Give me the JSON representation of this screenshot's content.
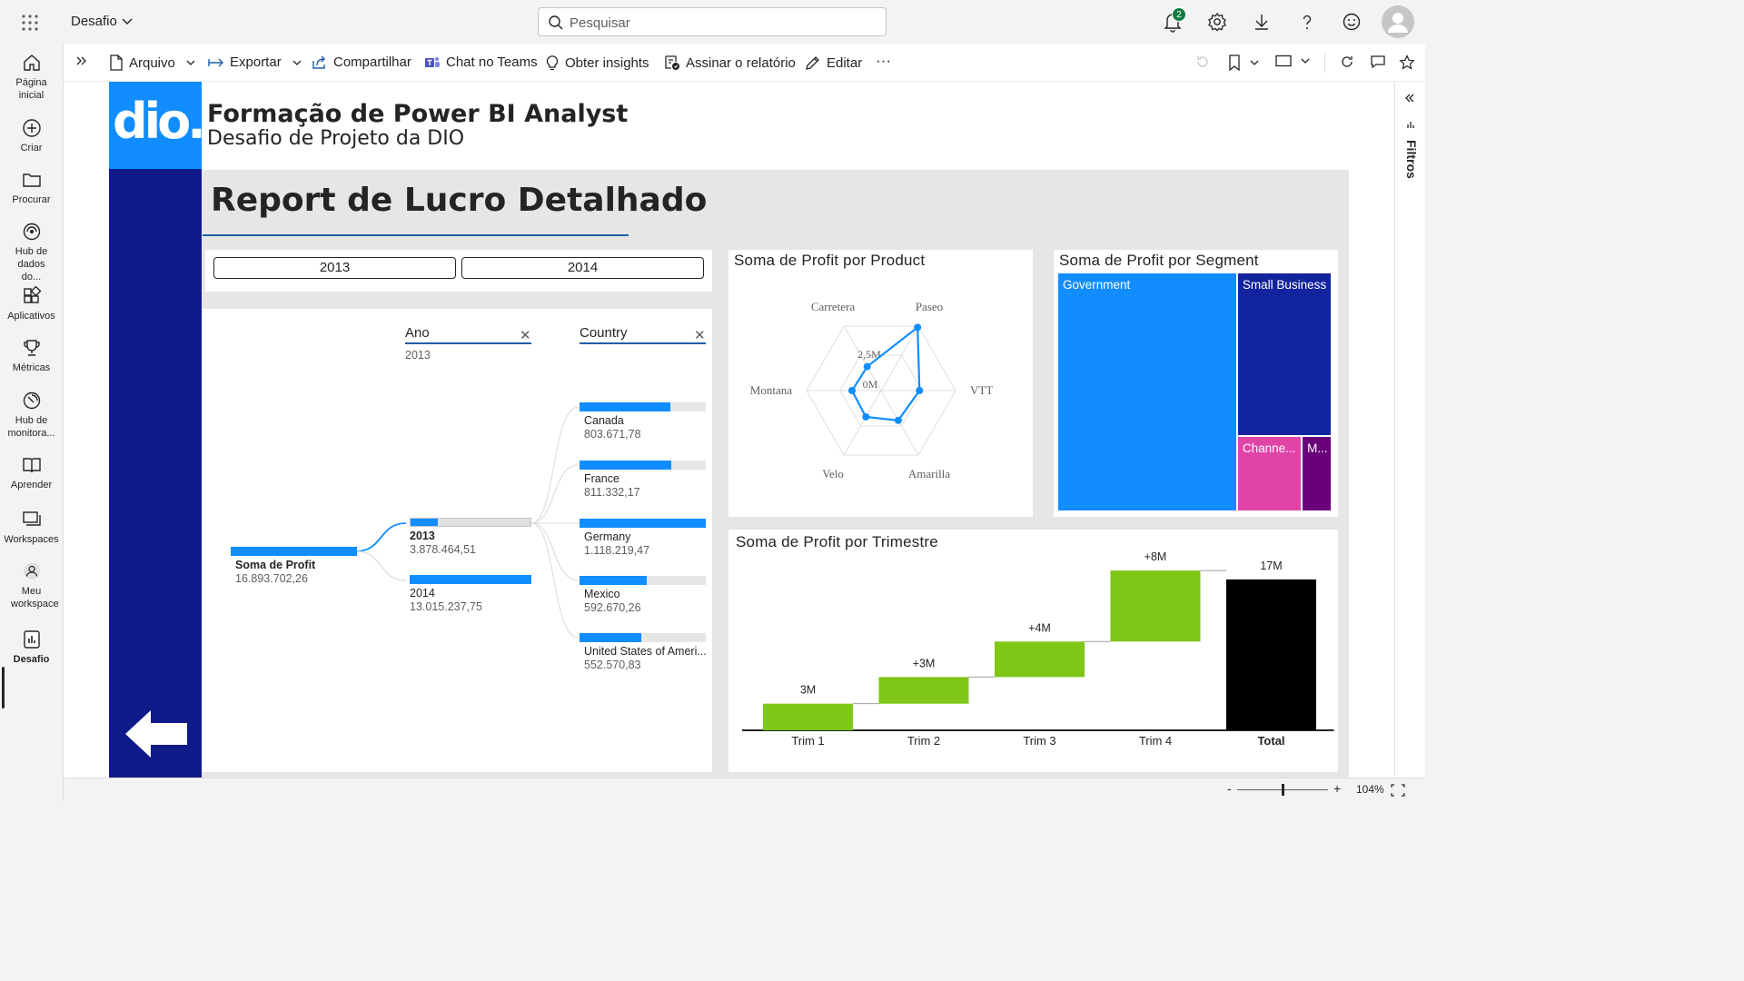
{
  "topbar": {
    "workspace_name": "Desafio",
    "search_placeholder": "Pesquisar",
    "notification_count": "2"
  },
  "leftnav": {
    "items": [
      {
        "label": "Página inicial",
        "icon": "home-icon"
      },
      {
        "label": "Criar",
        "icon": "plus-circle-icon"
      },
      {
        "label": "Procurar",
        "icon": "folder-icon"
      },
      {
        "label": "Hub de dados do...",
        "icon": "data-hub-icon"
      },
      {
        "label": "Aplicativos",
        "icon": "apps-icon"
      },
      {
        "label": "Métricas",
        "icon": "trophy-icon"
      },
      {
        "label": "Hub de monitora...",
        "icon": "monitor-hub-icon"
      },
      {
        "label": "Aprender",
        "icon": "book-icon"
      },
      {
        "label": "Workspaces",
        "icon": "workspaces-icon"
      },
      {
        "label": "Meu workspace",
        "icon": "person-icon"
      },
      {
        "label": "Desafio",
        "icon": "report-icon"
      }
    ]
  },
  "actionbar": {
    "file": "Arquivo",
    "export": "Exportar",
    "share": "Compartilhar",
    "teams": "Chat no Teams",
    "insights": "Obter insights",
    "subscribe": "Assinar o relatório",
    "edit": "Editar",
    "more": "···"
  },
  "filters_pane_label": "Filtros",
  "statusbar": {
    "zoom_minus": "-",
    "zoom_plus": "+",
    "zoom": "104%"
  },
  "report": {
    "logo_text": "dio.",
    "title": "Formação de Power BI Analyst",
    "subtitle": "Desafio de Projeto da DIO",
    "page_title": "Report de Lucro Detalhado",
    "slicer": [
      "2013",
      "2014"
    ],
    "decomp": {
      "root_label": "Soma de Profit",
      "root_value": "16.893.702,26",
      "col1_header": "Ano",
      "col1_filter": "2013",
      "col2_header": "Country",
      "years": [
        {
          "label": "2013",
          "value": "3.878.464,51",
          "fill": 0.23
        },
        {
          "label": "2014",
          "value": "13.015.237,75",
          "fill": 1.0
        }
      ],
      "countries": [
        {
          "label": "Canada",
          "value": "803.671,78",
          "fill": 0.72
        },
        {
          "label": "France",
          "value": "811.332,17",
          "fill": 0.73
        },
        {
          "label": "Germany",
          "value": "1.118.219,47",
          "fill": 1.0
        },
        {
          "label": "Mexico",
          "value": "592.670,26",
          "fill": 0.53
        },
        {
          "label": "United States of Ameri...",
          "value": "552.570,83",
          "fill": 0.49
        }
      ]
    },
    "radar_title": "Soma de Profit por Product",
    "segment_title": "Soma de Profit por Segment",
    "waterfall_title": "Soma de Profit por Trimestre"
  },
  "chart_data": [
    {
      "type": "radar",
      "title": "Soma de Profit por Product",
      "categories": [
        "Paseo",
        "VTT",
        "Amarilla",
        "Velo",
        "Montana",
        "Carretera"
      ],
      "values": [
        4.8,
        2.2,
        1.9,
        1.6,
        1.5,
        1.4
      ],
      "unit": "M",
      "ticks": [
        "0M",
        "2,5M"
      ],
      "rmax": 5.5,
      "color": "#118dff"
    },
    {
      "type": "treemap",
      "title": "Soma de Profit por Segment",
      "categories": [
        "Government",
        "Small Business",
        "Channe...",
        "M..."
      ],
      "values": [
        11.4,
        4.1,
        1.3,
        0.6
      ],
      "colors": [
        "#118dff",
        "#12239e",
        "#e044a7",
        "#6b007b"
      ]
    },
    {
      "type": "bar",
      "subtype": "waterfall",
      "title": "Soma de Profit por Trimestre",
      "categories": [
        "Trim 1",
        "Trim 2",
        "Trim 3",
        "Trim 4",
        "Total"
      ],
      "values": [
        3,
        3,
        4,
        8,
        17
      ],
      "data_labels": [
        "3M",
        "+3M",
        "+4M",
        "+8M",
        "17M"
      ],
      "ylim": [
        0,
        17.5
      ],
      "colors": {
        "increase": "#7ec716",
        "total": "#000000"
      }
    }
  ]
}
